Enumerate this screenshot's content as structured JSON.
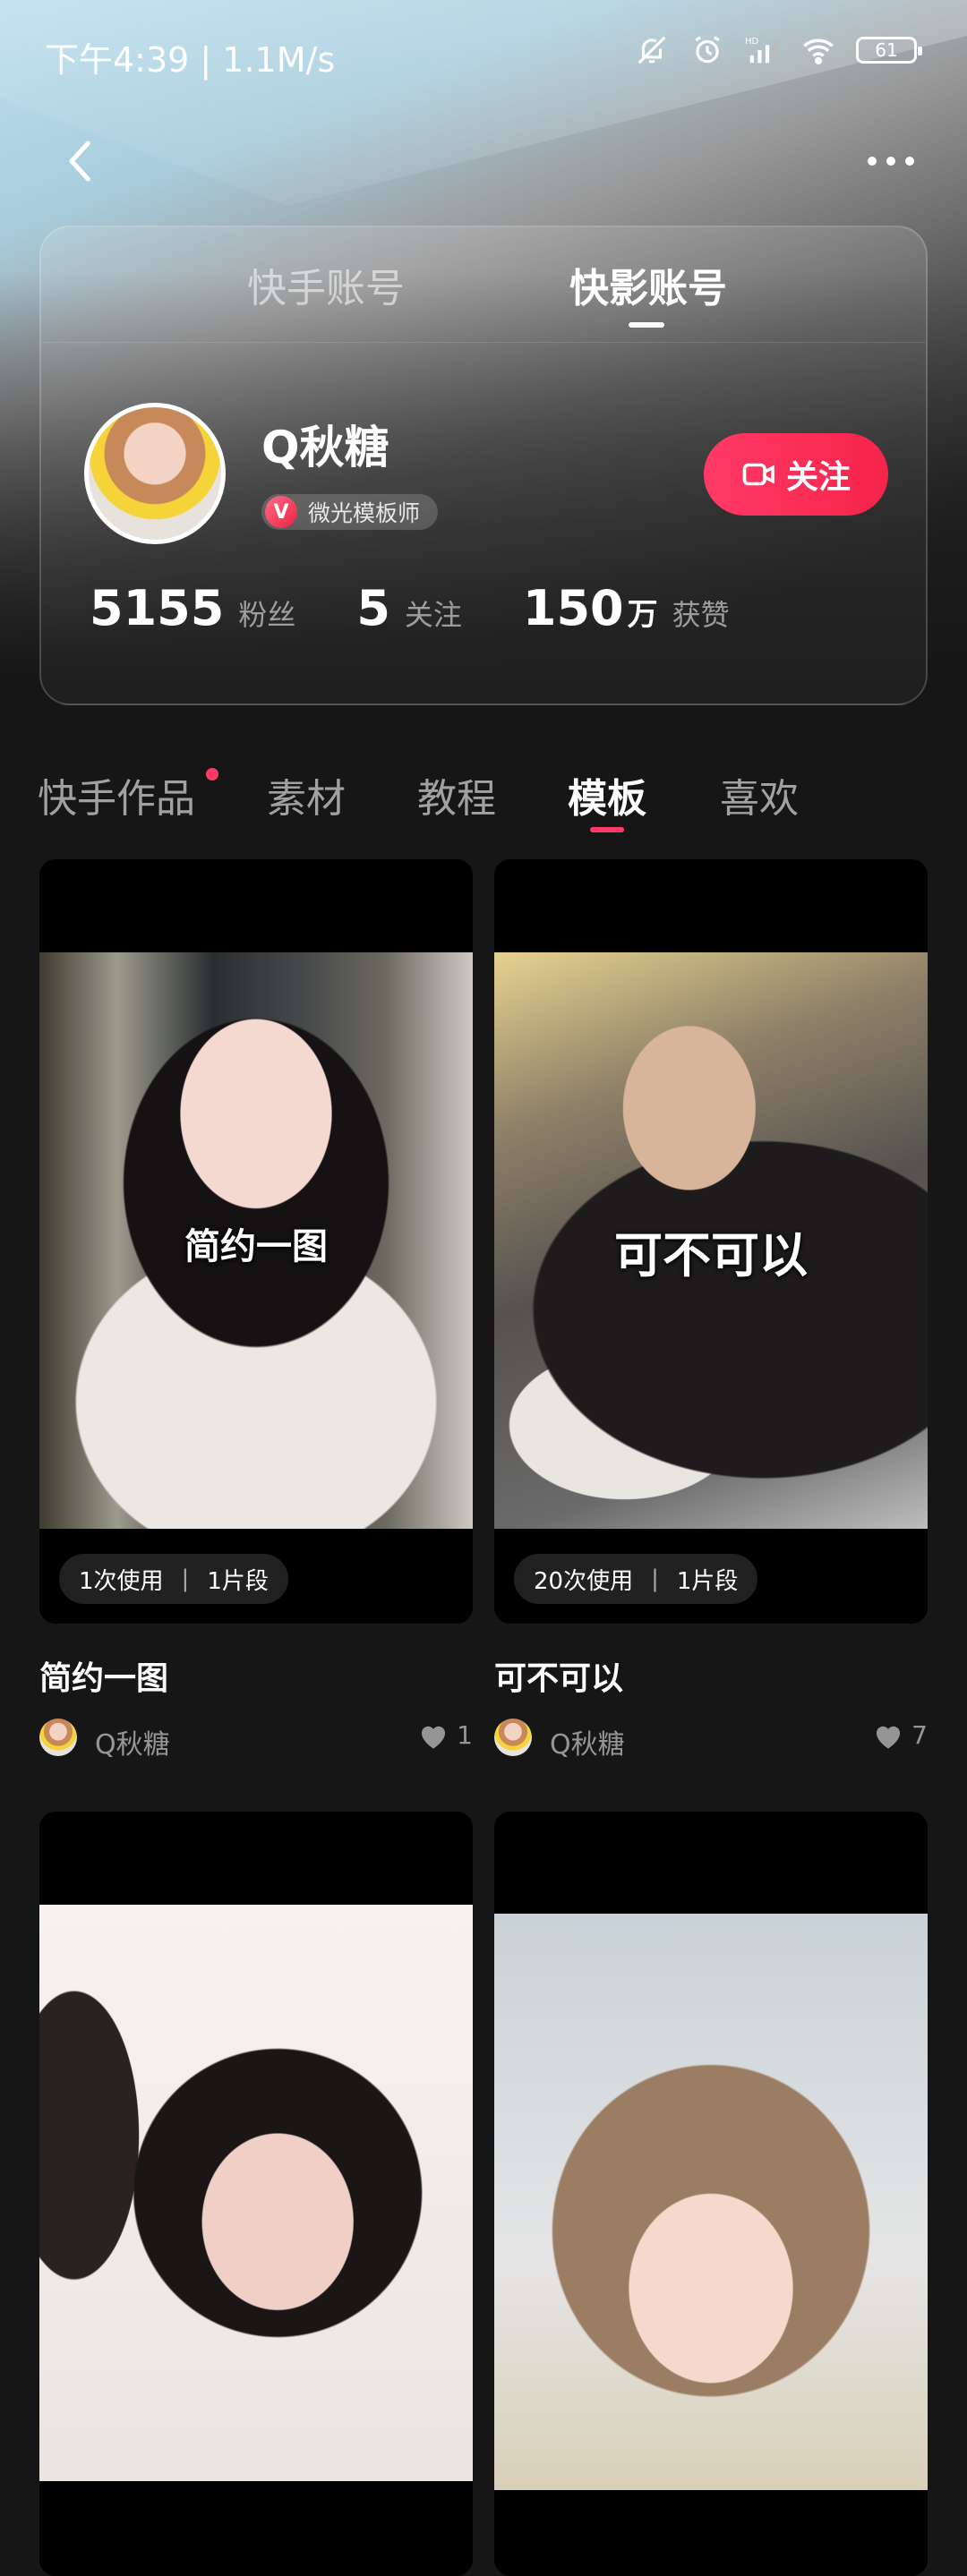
{
  "status_bar": {
    "time_speed": "下午4:39 | 1.1M/s",
    "battery": "61",
    "icons": [
      "mute-bell-icon",
      "alarm-icon",
      "hd-signal-icon",
      "wifi-icon",
      "battery-icon"
    ]
  },
  "nav": {
    "back_icon": "chevron-left-icon",
    "more_icon": "more-dots-icon"
  },
  "account_tabs": [
    "快手账号",
    "快影账号"
  ],
  "account_tabs_active": 1,
  "profile": {
    "username": "Q秋糖",
    "badge_letter": "V",
    "badge_text": "微光模板师",
    "follow_label": "关注",
    "stats": {
      "fans_value": "5155",
      "fans_label": "粉丝",
      "following_value": "5",
      "following_label": "关注",
      "likes_value": "150",
      "likes_unit": "万",
      "likes_label": "获赞"
    }
  },
  "content_tabs": [
    "快手作品",
    "素材",
    "教程",
    "模板",
    "喜欢"
  ],
  "content_tabs_active": 3,
  "templates": [
    {
      "overlay": "简约一图",
      "uses": "1次使用",
      "segments": "1片段",
      "title": "简约一图",
      "author": "Q秋糖",
      "likes": "1"
    },
    {
      "overlay": "可不可以",
      "uses": "20次使用",
      "segments": "1片段",
      "title": "可不可以",
      "author": "Q秋糖",
      "likes": "7"
    }
  ],
  "colors": {
    "accent": "#FF3A66",
    "background": "#161616"
  }
}
